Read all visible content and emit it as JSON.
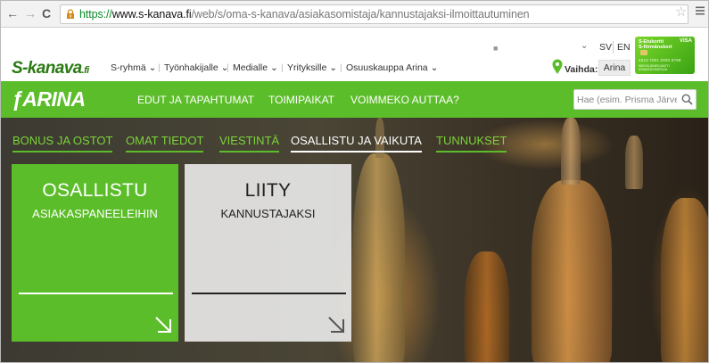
{
  "browser": {
    "url_https": "https://",
    "url_host": "www.s-kanava.fi",
    "url_path": "/web/s/oma-s-kanava/asiakasomistaja/kannustajaksi-ilmoittautuminen"
  },
  "topnav": {
    "logo_main": "S-kanava",
    "logo_suffix": ".fi",
    "items": [
      {
        "label": "S-ryhmä"
      },
      {
        "label": "Työnhakijalle"
      },
      {
        "label": "Medialle"
      },
      {
        "label": "Yrityksille"
      },
      {
        "label": "Osuuskauppa Arina"
      }
    ],
    "lang_sv": "SV",
    "lang_en": "EN",
    "vaihda_label": "Vaihda:",
    "vaihda_value": "Arina",
    "card": {
      "title": "S-Etukortti",
      "subtitle": "S-förmånskort",
      "brand": "VISA",
      "number": "4516 7001 0000 8789",
      "name_lines": [
        "MEIKÄLÄINEN MATTI",
        "ASIAKASOMISTAJA"
      ]
    }
  },
  "arina": {
    "logo": "ARINA",
    "nav": [
      {
        "label": "EDUT JA TAPAHTUMAT"
      },
      {
        "label": "TOIMIPAIKAT"
      },
      {
        "label": "VOIMMEKO AUTTAA?"
      }
    ],
    "search_placeholder": "Hae (esim. Prisma Järve"
  },
  "tabs": [
    {
      "label": "BONUS JA OSTOT",
      "active": false
    },
    {
      "label": "OMAT TIEDOT",
      "active": false
    },
    {
      "label": "VIESTINTÄ",
      "active": false
    },
    {
      "label": "OSALLISTU JA VAIKUTA",
      "active": true
    },
    {
      "label": "TUNNUKSET",
      "active": false
    }
  ],
  "tiles": {
    "green": {
      "title": "OSALLISTU",
      "subtitle": "ASIAKASPANEELEIHIN"
    },
    "gray": {
      "title": "LIITY",
      "subtitle": "KANNUSTAJAKSI"
    }
  },
  "colors": {
    "brand_green": "#5cbd2a",
    "tab_green": "#7bd43a"
  }
}
